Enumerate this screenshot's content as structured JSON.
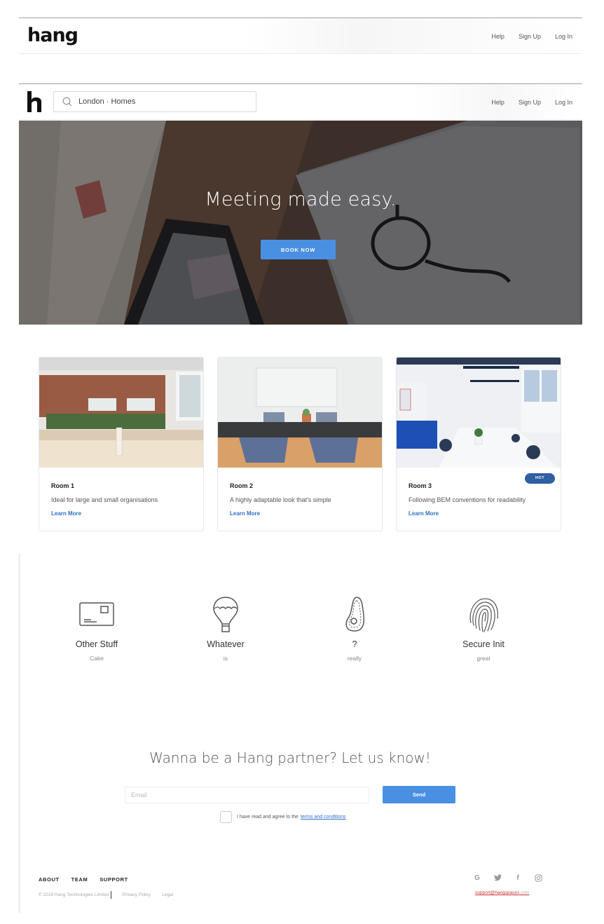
{
  "nav_top": {
    "logo_text": "hang",
    "links": [
      "Help",
      "Sign Up",
      "Log In"
    ]
  },
  "nav_search": {
    "logo_text": "h",
    "search_value": "London · Homes",
    "links": [
      "Help",
      "Sign Up",
      "Log In"
    ]
  },
  "hero": {
    "title": "Meeting made easy.",
    "cta_label": "BOOK NOW"
  },
  "rooms": [
    {
      "title": "Room 1",
      "description": "Ideal for large and small organisations",
      "link": "Learn More",
      "badge": ""
    },
    {
      "title": "Room 2",
      "description": "A highly adaptable look that's simple",
      "link": "Learn More",
      "badge": ""
    },
    {
      "title": "Room 3",
      "description": "Following BEM conventions for readability",
      "link": "Learn More",
      "badge": "HOT"
    }
  ],
  "features": [
    {
      "icon": "card-icon",
      "title": "Other Stuff",
      "subtitle": "Cake"
    },
    {
      "icon": "hot-air-balloon-icon",
      "title": "Whatever",
      "subtitle": "is"
    },
    {
      "icon": "avocado-icon",
      "title": "?",
      "subtitle": "really"
    },
    {
      "icon": "fingerprint-icon",
      "title": "Secure Init",
      "subtitle": "great"
    }
  ],
  "partner": {
    "title": "Wanna be a Hang partner? Let us know!",
    "email_placeholder": "Email",
    "send_label": "Send",
    "agree_text": "I have read and agree to the",
    "terms_link": "terms and conditions"
  },
  "footer": {
    "nav": [
      "ABOUT",
      "TEAM",
      "SUPPORT"
    ],
    "copyright": "© 2018 Hang Technologies Limited",
    "privacy": "Privacy Policy",
    "legal": "Legal",
    "social": [
      "google-icon",
      "twitter-icon",
      "facebook-icon",
      "instagram-icon"
    ],
    "support_email_user": "support@hangspaces",
    "support_email_domain": ".com"
  },
  "colors": {
    "accent": "#4a90e2",
    "badge": "#2f5fa3",
    "link": "#2f6fc6"
  }
}
